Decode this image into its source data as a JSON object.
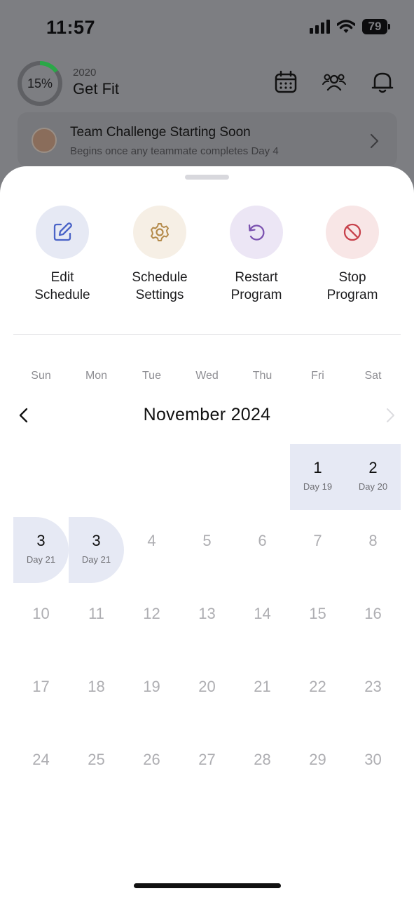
{
  "status_bar": {
    "time": "11:57",
    "battery": "79"
  },
  "header": {
    "progress": "15%",
    "year": "2020",
    "title": "Get Fit"
  },
  "challenge": {
    "title": "Team Challenge Starting Soon",
    "subtitle": "Begins once any teammate completes Day 4"
  },
  "actions": [
    {
      "label": "Edit\nSchedule",
      "bg": "#e6e9f4",
      "color": "#4a63c7",
      "icon": "edit-icon"
    },
    {
      "label": "Schedule\nSettings",
      "bg": "#f6efe5",
      "color": "#b48a4a",
      "icon": "gear-icon"
    },
    {
      "label": "Restart\nProgram",
      "bg": "#ece6f5",
      "color": "#7b52b0",
      "icon": "restart-icon"
    },
    {
      "label": "Stop\nProgram",
      "bg": "#f8e6e6",
      "color": "#c7414b",
      "icon": "stop-icon"
    }
  ],
  "calendar": {
    "weekdays": [
      "Sun",
      "Mon",
      "Tue",
      "Wed",
      "Thu",
      "Fri",
      "Sat"
    ],
    "month": "November 2024",
    "weeks": [
      [
        null,
        null,
        null,
        null,
        null,
        {
          "d": "1",
          "s": "Day 19",
          "on": true
        },
        {
          "d": "2",
          "s": "Day 20",
          "on": true
        }
      ],
      [
        {
          "d": "3",
          "s": "Day 21",
          "on": true,
          "round": true
        },
        {
          "d": "3",
          "s": "Day 21",
          "on": true,
          "round": true
        },
        {
          "d": "4"
        },
        {
          "d": "5"
        },
        {
          "d": "6"
        },
        {
          "d": "7"
        },
        {
          "d": "8"
        }
      ],
      [
        {
          "d": "10"
        },
        {
          "d": "11"
        },
        {
          "d": "12"
        },
        {
          "d": "13"
        },
        {
          "d": "14"
        },
        {
          "d": "15"
        },
        {
          "d": "16"
        }
      ],
      [
        {
          "d": "17"
        },
        {
          "d": "18"
        },
        {
          "d": "19"
        },
        {
          "d": "20"
        },
        {
          "d": "21"
        },
        {
          "d": "22"
        },
        {
          "d": "23"
        }
      ],
      [
        {
          "d": "24"
        },
        {
          "d": "25"
        },
        {
          "d": "26"
        },
        {
          "d": "27"
        },
        {
          "d": "28"
        },
        {
          "d": "29"
        },
        {
          "d": "30"
        }
      ]
    ]
  }
}
